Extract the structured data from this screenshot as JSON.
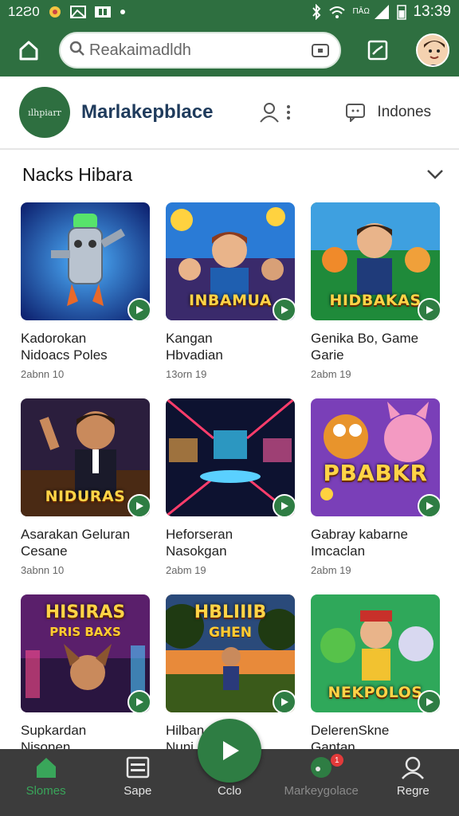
{
  "status_bar": {
    "left_time": "12Ƨ0",
    "right_time": "13:39",
    "signal_text": "ΠĀΩ"
  },
  "app_bar": {
    "search_placeholder": "Reakaimadldh"
  },
  "store": {
    "logo_text": "ılhpiarr",
    "brand": "Marlakepblace",
    "language": "Indones"
  },
  "section": {
    "title": "Nacks Hibara"
  },
  "colors": {
    "primary": "#2e6f40",
    "accent": "#2e7d43",
    "nav_bg": "#3c3c3c",
    "active_nav": "#39a65a"
  },
  "cards": [
    {
      "title1": "Kadorokan",
      "title2": "Nidoacs Poles",
      "meta": "2abnn 10",
      "overlay": ""
    },
    {
      "title1": "Kangan",
      "title2": "Hbvadian",
      "meta": "13orn 19",
      "overlay": "INBAMUA"
    },
    {
      "title1": "Genika Bo, Game",
      "title2": "Garie",
      "meta": "2abm 19",
      "overlay": "HIDBAKAS"
    },
    {
      "title1": "Asarakan Geluran",
      "title2": "Cesane",
      "meta": "3abnn 10",
      "overlay": "NIDURAS"
    },
    {
      "title1": "Heforseran",
      "title2": "Nasokgan",
      "meta": "2abm 19",
      "overlay": ""
    },
    {
      "title1": "Gabray kabarne",
      "title2": "Imcaclan",
      "meta": "2abm 19",
      "overlay": "PBABKR"
    },
    {
      "title1": "Supkardan",
      "title2": "Nisonen",
      "meta": "",
      "overlay": "HISIRAS",
      "overlay_sub": "PRIS BAXS"
    },
    {
      "title1": "Hilban",
      "title2": "Nuni",
      "meta": "",
      "overlay": "HBLIIIB",
      "overlay_sub": "GHEN"
    },
    {
      "title1": "DelerenSkne",
      "title2": "Gantan",
      "meta": "",
      "overlay": "NEKPOLOS"
    }
  ],
  "bottom_nav": [
    {
      "label": "Slomes",
      "icon": "home-icon"
    },
    {
      "label": "Sape",
      "icon": "list-icon"
    },
    {
      "label": "Cclo",
      "icon": "play-icon"
    },
    {
      "label": "Markeygolace",
      "icon": "marketplace-icon",
      "badge": "1"
    },
    {
      "label": "Regre",
      "icon": "profile-icon"
    }
  ]
}
